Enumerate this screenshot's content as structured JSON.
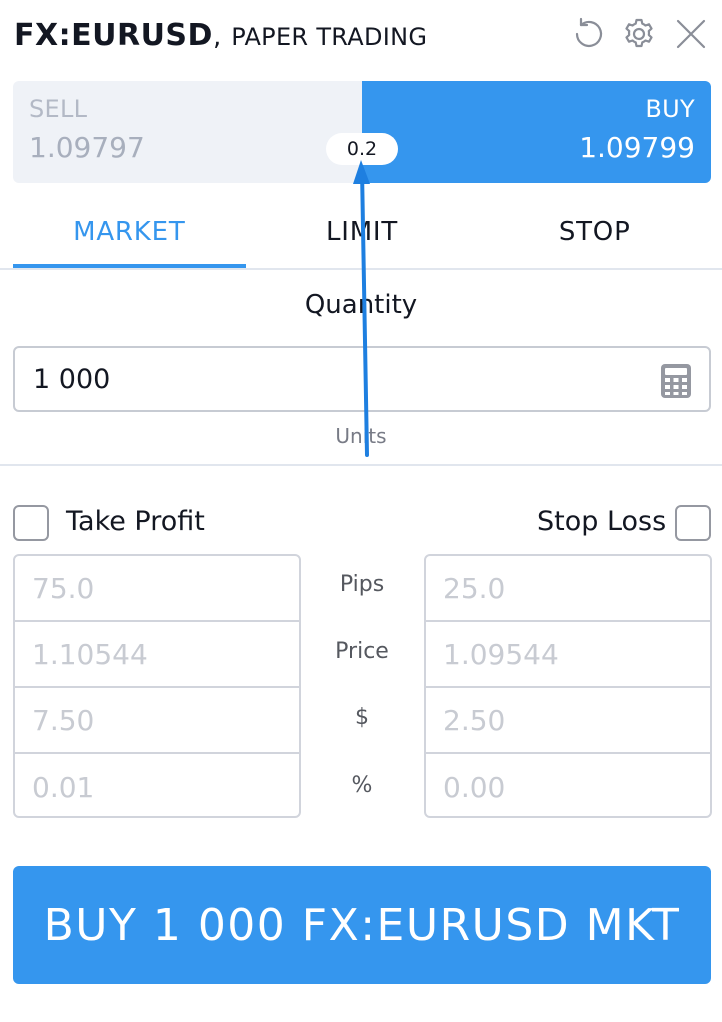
{
  "header": {
    "symbol": "FX:EURUSD",
    "separator": ",",
    "mode": "PAPER TRADING",
    "icons": [
      "reset-icon",
      "gear-icon",
      "close-icon"
    ]
  },
  "prices": {
    "sell_label": "SELL",
    "sell_price": "1.09797",
    "buy_label": "BUY",
    "buy_price": "1.09799",
    "spread": "0.2"
  },
  "tabs": [
    {
      "label": "MARKET",
      "active": true
    },
    {
      "label": "LIMIT",
      "active": false
    },
    {
      "label": "STOP",
      "active": false
    }
  ],
  "quantity": {
    "label": "Quantity",
    "value": "1 000",
    "units": "Units"
  },
  "take_profit": {
    "label": "Take Profit",
    "checked": false,
    "pips": "75.0",
    "price": "1.10544",
    "money": "7.50",
    "percent": "0.01"
  },
  "stop_loss": {
    "label": "Stop Loss",
    "checked": false,
    "pips": "25.0",
    "price": "1.09544",
    "money": "2.50",
    "percent": "0.00"
  },
  "row_labels": {
    "pips": "Pips",
    "price": "Price",
    "money": "$",
    "percent": "%"
  },
  "action": {
    "label": "BUY 1 000 FX:EURUSD MKT"
  },
  "colors": {
    "accent": "#3596ee",
    "sell_bg": "#eff2f7",
    "annotation_arrow": "#1e7fe0"
  }
}
